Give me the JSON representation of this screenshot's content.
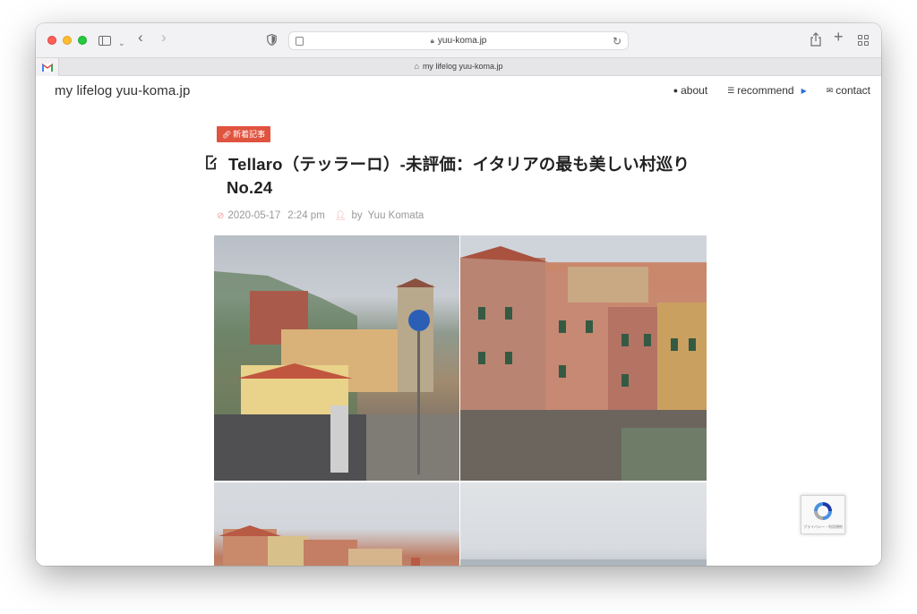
{
  "browser": {
    "url": "yuu-koma.jp",
    "active_tab_title": "my lifelog yuu-koma.jp"
  },
  "site": {
    "title": "my lifelog yuu-koma.jp",
    "nav": [
      {
        "label": "about",
        "icon": "info-circle-icon"
      },
      {
        "label": "recommend",
        "icon": "list-icon"
      },
      {
        "label": "contact",
        "icon": "envelope-icon"
      }
    ]
  },
  "post": {
    "category": "新着記事",
    "title_line1": "Tellaro（テッラーロ）-未評価：イタリアの最も美しい村巡り",
    "title_line2": "No.24",
    "date": "2020-05-17",
    "time": "2:24 pm",
    "by": "by",
    "author": "Yuu Komata"
  },
  "recaptcha": {
    "terms": "プライバシー・利用規約"
  },
  "colors": {
    "accent": "#e0533f",
    "meta_icon": "#f0a0a0",
    "nav_caret": "#2e6fd6"
  }
}
